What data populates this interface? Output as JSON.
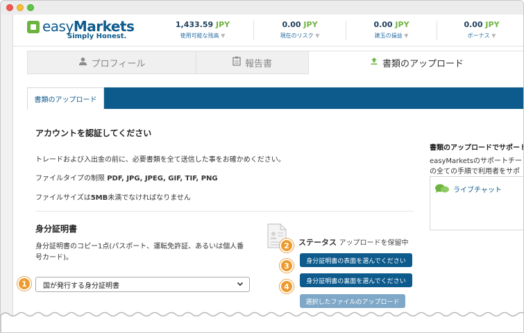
{
  "header": {
    "logo": {
      "brand_light": "easy",
      "brand_bold": "Markets",
      "tagline": "Simply Honest."
    },
    "stats": [
      {
        "value": "1,433.59",
        "currency": "JPY",
        "label": "使用可能な残高"
      },
      {
        "value": "0.00",
        "currency": "JPY",
        "label": "現在のリスク"
      },
      {
        "value": "0.00",
        "currency": "JPY",
        "label": "建玉の損益"
      },
      {
        "value": "0.00",
        "currency": "JPY",
        "label": "ボーナス"
      }
    ]
  },
  "tabs": [
    {
      "label": "プロフィール",
      "icon": "user-icon"
    },
    {
      "label": "報告書",
      "icon": "clipboard-icon"
    },
    {
      "label": "書類のアップロード",
      "icon": "upload-icon"
    }
  ],
  "section_tab": {
    "label": "書類のアップロード"
  },
  "main": {
    "title": "アカウントを認証してください",
    "intro": "トレードおよび入出金の前に、必要書類を全て送信した事をお確かめください。",
    "filetypes_prefix": "ファイルタイプの制限 ",
    "filetypes": "PDF, JPG, JPEG, GIF, TIF, PNG",
    "filesize_prefix": "ファイルサイズは",
    "filesize_value": "5MB",
    "filesize_suffix": "未満でなければなりません",
    "id_section": {
      "title": "身分証明書",
      "description": "身分証明書のコピー1点(パスポート、運転免許証、あるいは個人番号カード)。",
      "select_value": "国が発行する身分証明書",
      "status_key": "ステータス",
      "status_value": "アップロードを保留中",
      "btn_front": "身分証明書の表面を選んでください",
      "btn_back": "身分証明書の裏面を選んでください",
      "btn_upload": "選択したファイルのアップロード"
    }
  },
  "steps": [
    "1",
    "2",
    "3",
    "4"
  ],
  "side": {
    "title": "書類のアップロードでサポート",
    "text_line1": "easyMarketsのサポートチー",
    "text_line2": "の全ての手順で利用者をサポ",
    "chat_label": "ライブチャット"
  },
  "colors": {
    "brand_blue": "#0d5a8c",
    "brand_green": "#6db33f",
    "step_orange": "#ee9a2c",
    "disabled_blue": "#7fa8c8"
  }
}
